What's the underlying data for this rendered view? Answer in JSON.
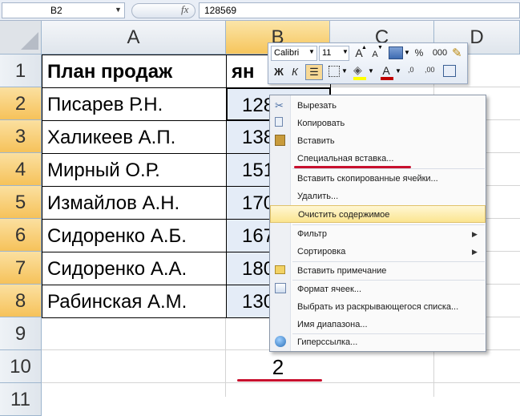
{
  "formula_bar": {
    "name_box": "B2",
    "fx_label": "fx",
    "formula_value": "128569"
  },
  "columns": [
    "A",
    "B",
    "C",
    "D"
  ],
  "rows": [
    "1",
    "2",
    "3",
    "4",
    "5",
    "6",
    "7",
    "8",
    "9",
    "10",
    "11"
  ],
  "sheet": {
    "header_a": "План продаж",
    "header_b": "ян",
    "names": [
      "Писарев Р.Н.",
      "Халикеев А.П.",
      "Мирный О.Р.",
      "Измайлов А.Н.",
      "Сидоренко А.Б.",
      "Сидоренко А.А.",
      "Рабинская А.М."
    ],
    "values_visible": [
      "128",
      "138",
      "151",
      "170",
      "167",
      "180",
      "130"
    ],
    "b10": "2"
  },
  "mini_toolbar": {
    "font_name": "Calibri",
    "font_size": "11",
    "grow_font": "A",
    "shrink_font": "A",
    "percent": "%",
    "thousands": "000",
    "bold": "Ж",
    "italic": "К",
    "font_color_letter": "A",
    "dec_increase": ",0",
    "dec_decrease": ",00",
    "font_color": "#c00000",
    "fill_color": "#ffff00"
  },
  "context_menu": {
    "items": [
      {
        "label": "Вырезать",
        "icon": "scissors-icon"
      },
      {
        "label": "Копировать",
        "icon": "copy-icon"
      },
      {
        "label": "Вставить",
        "icon": "paste-icon"
      },
      {
        "label": "Специальная вставка..."
      },
      {
        "label": "Вставить скопированные ячейки..."
      },
      {
        "label": "Удалить..."
      },
      {
        "label": "Очистить содержимое",
        "highlighted": true
      },
      {
        "label": "Фильтр",
        "submenu": true
      },
      {
        "label": "Сортировка",
        "submenu": true
      },
      {
        "label": "Вставить примечание",
        "icon": "comment-icon"
      },
      {
        "label": "Формат ячеек...",
        "icon": "format-cells-icon"
      },
      {
        "label": "Выбрать из раскрывающегося списка..."
      },
      {
        "label": "Имя диапазона..."
      },
      {
        "label": "Гиперссылка...",
        "icon": "hyperlink-icon"
      }
    ]
  },
  "colors": {
    "selection_header": "#f6c55c",
    "menu_highlight": "#fbe590",
    "annotation_red": "#c8102e"
  }
}
